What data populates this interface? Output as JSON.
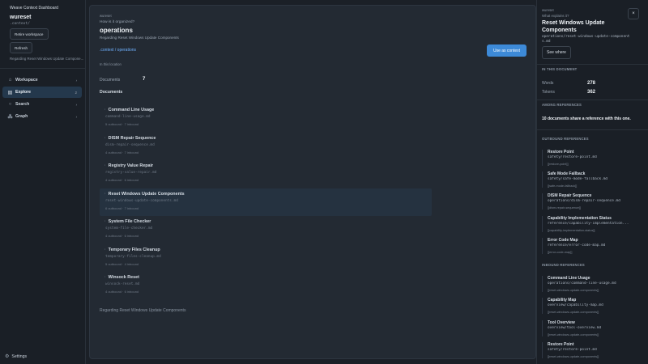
{
  "sidebar": {
    "app_title": "Weave Context Dashboard",
    "workspace_name": "wureset",
    "workspace_path": ".context/",
    "retire_label": "Retire workspace",
    "refresh_label": "Refresh",
    "caption": "Regarding Reset Windows Update Compone...",
    "nav": [
      {
        "label": "Workspace",
        "icon": "home",
        "count": "›"
      },
      {
        "label": "Explore",
        "icon": "folder",
        "count": "2"
      },
      {
        "label": "Search",
        "icon": "search",
        "count": "›"
      },
      {
        "label": "Graph",
        "icon": "graph",
        "count": "›"
      }
    ],
    "settings_label": "Settings"
  },
  "main": {
    "eyebrow": "wureset",
    "question": "How is it organized?",
    "title": "operations",
    "subtitle": "Regarding Reset Windows Update Components",
    "breadcrumb": ".context / operations",
    "use_button": "Use as context",
    "location": "In this location",
    "documents_label": "Documents",
    "documents_count": "7",
    "documents_heading": "Documents",
    "documents": [
      {
        "title": "Command Line Usage",
        "path": "command-line-usage.md",
        "meta": "5 outbound · 7 inbound"
      },
      {
        "title": "DISM Repair Sequence",
        "path": "dism-repair-sequence.md",
        "meta": "4 outbound · 7 inbound"
      },
      {
        "title": "Registry Value Repair",
        "path": "registry-value-repair.md",
        "meta": "4 outbound · 6 inbound"
      },
      {
        "title": "Reset Windows Update Components",
        "path": "reset-windows-update-components.md",
        "meta": "6 outbound · 7 inbound"
      },
      {
        "title": "System File Checker",
        "path": "system-file-checker.md",
        "meta": "4 outbound · 6 inbound"
      },
      {
        "title": "Temporary Files Cleanup",
        "path": "temporary-files-cleanup.md",
        "meta": "5 outbound · 4 inbound"
      },
      {
        "title": "Winsock Reset",
        "path": "winsock-reset.md",
        "meta": "4 outbound · 6 inbound"
      }
    ],
    "footer": "Regarding Reset Windows Update Components"
  },
  "detail": {
    "eyebrow": "wureset",
    "question": "What explains it?",
    "title": "Reset Windows Update Components",
    "path": "operations/reset-windows-update-components.md",
    "close_label": "×",
    "see_where_label": "See where",
    "in_doc_heading": "IN THIS DOCUMENT",
    "words_label": "Words",
    "words_value": "278",
    "tokens_label": "Tokens",
    "tokens_value": "362",
    "among_heading": "AMONG REFERENCES",
    "among_text": "10 documents share a reference with this one.",
    "outbound_heading": "OUTBOUND REFERENCES",
    "outbound": [
      {
        "title": "Restore Point",
        "path": "safety/restore-point.md",
        "anchor": "[[restore-point]]"
      },
      {
        "title": "Safe Mode Fallback",
        "path": "safety/safe-mode-fallback.md",
        "anchor": "[[safe-mode-fallback]]"
      },
      {
        "title": "DISM Repair Sequence",
        "path": "operations/dism-repair-sequence.md",
        "anchor": "[[dism-repair-sequence]]"
      },
      {
        "title": "Capability Implementation Status",
        "path": "reference/capability-implementation...",
        "anchor": "[[capability-implementation-status]]"
      },
      {
        "title": "Error Code Map",
        "path": "reference/error-code-map.md",
        "anchor": "[[error-code-map]]"
      }
    ],
    "inbound_heading": "INBOUND REFERENCES",
    "inbound": [
      {
        "title": "Command Line Usage",
        "path": "operations/command-line-usage.md",
        "anchor": "[[reset-windows-update-components]]"
      },
      {
        "title": "Capability Map",
        "path": "overview/capability-map.md",
        "anchor": "[[reset-windows-update-components]]"
      },
      {
        "title": "Tool Overview",
        "path": "overview/tool-overview.md",
        "anchor": "[[reset-windows-update-components]]"
      },
      {
        "title": "Restore Point",
        "path": "safety/restore-point.md",
        "anchor": "[[reset-windows-update-components]]"
      }
    ]
  }
}
